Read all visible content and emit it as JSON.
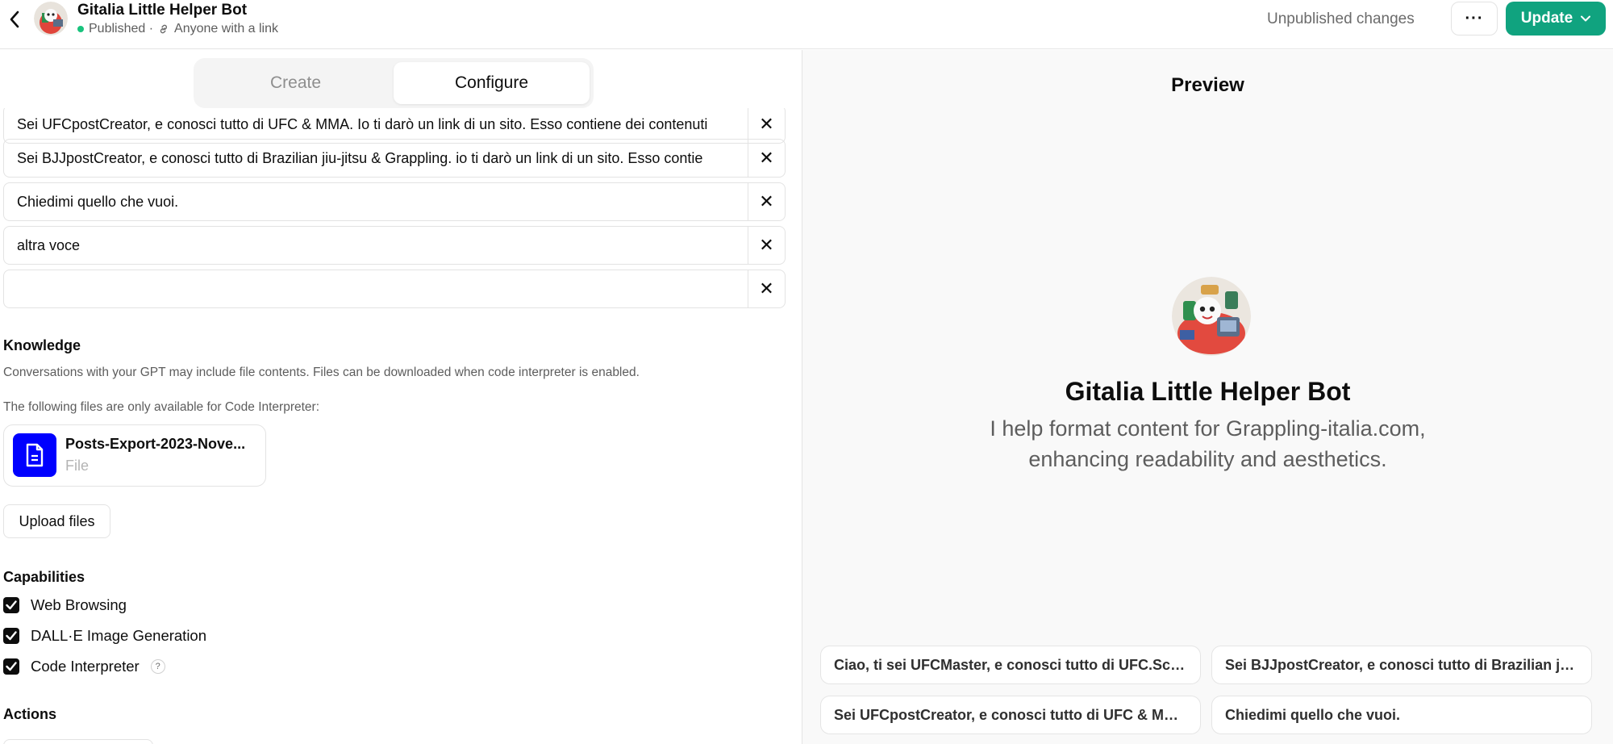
{
  "header": {
    "title": "Gitalia Little Helper Bot",
    "status": "Published ·",
    "visibility": "Anyone with a link",
    "unpublished": "Unpublished changes",
    "more_label": "···",
    "update_label": "Update"
  },
  "tabs": [
    {
      "label": "Create"
    },
    {
      "label": "Configure"
    }
  ],
  "starters": [
    "Sei UFCpostCreator, e conosci tutto di UFC & MMA. Io ti darò un link di un sito. Esso contiene dei contenuti",
    "Sei BJJpostCreator, e conosci tutto di Brazilian jiu-jitsu & Grappling.  io ti darò un link di un sito.  Esso contie",
    "Chiedimi quello che vuoi.",
    "altra voce",
    ""
  ],
  "knowledge": {
    "title": "Knowledge",
    "desc": "Conversations with your GPT may include file contents. Files can be downloaded when code interpreter is enabled.",
    "note": "The following files are only available for Code Interpreter:",
    "file_name": "Posts-Export-2023-Nove...",
    "file_type": "File",
    "upload_label": "Upload files"
  },
  "capabilities": {
    "title": "Capabilities",
    "items": [
      {
        "label": "Web Browsing",
        "checked": true
      },
      {
        "label": "DALL·E Image Generation",
        "checked": true
      },
      {
        "label": "Code Interpreter",
        "checked": true
      }
    ]
  },
  "actions": {
    "title": "Actions"
  },
  "preview": {
    "title": "Preview",
    "bot_name": "Gitalia Little Helper Bot",
    "desc_line1": "I help format content for Grappling-italia.com,",
    "desc_line2": "enhancing readability and aesthetics.",
    "suggestions": [
      "Ciao, ti sei UFCMaster, e conosci tutto di UFC.Scriv...",
      "Sei BJJpostCreator, e conosci tutto di Brazilian jiu-j...",
      "Sei UFCpostCreator, e conosci tutto di UFC & MMA...",
      "Chiedimi quello che vuoi."
    ]
  },
  "colors": {
    "accent": "#10a37f",
    "file_icon": "#0000ff",
    "published_dot": "#19c37d"
  }
}
